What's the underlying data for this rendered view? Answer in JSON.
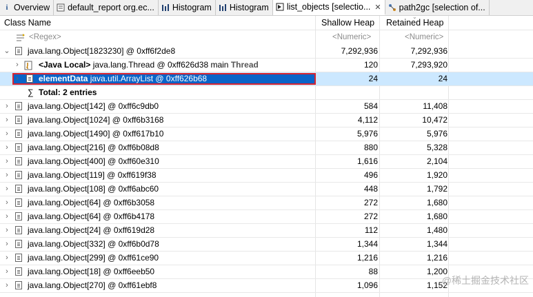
{
  "tabs": [
    {
      "label": "Overview",
      "icon": "info-icon",
      "active": false
    },
    {
      "label": "default_report  org.ec...",
      "icon": "report-icon",
      "active": false
    },
    {
      "label": "Histogram",
      "icon": "histogram-icon",
      "active": false
    },
    {
      "label": "Histogram",
      "icon": "histogram-icon",
      "active": false
    },
    {
      "label": "list_objects  [selectio...",
      "icon": "list-icon",
      "active": true,
      "close": "✕"
    },
    {
      "label": "path2gc  [selection of...",
      "icon": "path-icon",
      "active": false
    }
  ],
  "columns": {
    "name": "Class Name",
    "shallow": "Shallow Heap",
    "retained": "Retained Heap"
  },
  "filters": {
    "name": "<Regex>",
    "shallow": "<Numeric>",
    "retained": "<Numeric>"
  },
  "rows": [
    {
      "name": "java.lang.Object[1823230] @ 0xff6f2de8",
      "shallow": "7,292,936",
      "retained": "7,292,936"
    },
    {
      "label_bold": "<Java Local>",
      "name": " java.lang.Thread @ 0xff626d38  main ",
      "name_suffix": "Thread",
      "shallow": "120",
      "retained": "7,293,920"
    },
    {
      "label_bold": "elementData",
      "name": " java.util.ArrayList @ 0xff626b68",
      "shallow": "24",
      "retained": "24"
    },
    {
      "label_bold": "Total: 2 entries",
      "shallow": "",
      "retained": ""
    },
    {
      "name": "java.lang.Object[142] @ 0xff6c9db0",
      "shallow": "584",
      "retained": "11,408"
    },
    {
      "name": "java.lang.Object[1024] @ 0xff6b3168",
      "shallow": "4,112",
      "retained": "10,472"
    },
    {
      "name": "java.lang.Object[1490] @ 0xff617b10",
      "shallow": "5,976",
      "retained": "5,976"
    },
    {
      "name": "java.lang.Object[216] @ 0xff6b08d8",
      "shallow": "880",
      "retained": "5,328"
    },
    {
      "name": "java.lang.Object[400] @ 0xff60e310",
      "shallow": "1,616",
      "retained": "2,104"
    },
    {
      "name": "java.lang.Object[119] @ 0xff619f38",
      "shallow": "496",
      "retained": "1,920"
    },
    {
      "name": "java.lang.Object[108] @ 0xff6abc60",
      "shallow": "448",
      "retained": "1,792"
    },
    {
      "name": "java.lang.Object[64] @ 0xff6b3058",
      "shallow": "272",
      "retained": "1,680"
    },
    {
      "name": "java.lang.Object[64] @ 0xff6b4178",
      "shallow": "272",
      "retained": "1,680"
    },
    {
      "name": "java.lang.Object[24] @ 0xff619d28",
      "shallow": "112",
      "retained": "1,480"
    },
    {
      "name": "java.lang.Object[332] @ 0xff6b0d78",
      "shallow": "1,344",
      "retained": "1,344"
    },
    {
      "name": "java.lang.Object[299] @ 0xff61ce90",
      "shallow": "1,216",
      "retained": "1,216"
    },
    {
      "name": "java.lang.Object[18] @ 0xff6eeb50",
      "shallow": "88",
      "retained": "1,200"
    },
    {
      "name": "java.lang.Object[270] @ 0xff61ebf8",
      "shallow": "1,096",
      "retained": "1,152"
    }
  ],
  "watermark": "@稀土掘金技术社区"
}
